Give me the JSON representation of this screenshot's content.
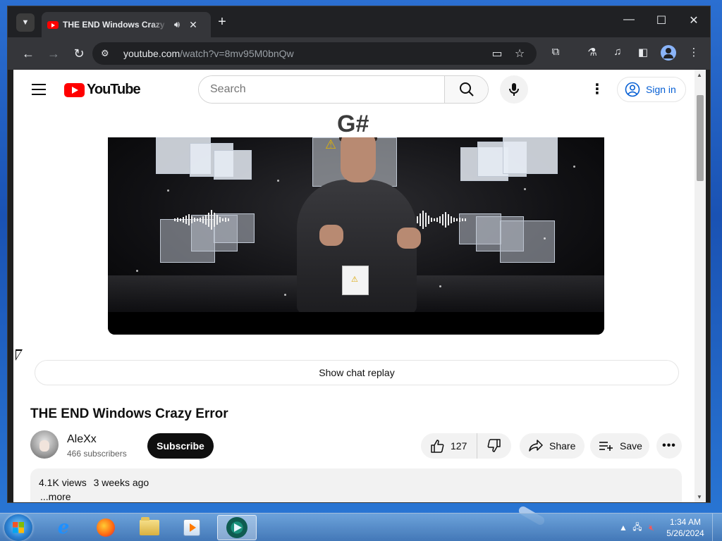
{
  "browser": {
    "tab": {
      "title": "THE END Windows Crazy Error",
      "audio_icon": "speaker-icon",
      "close_glyph": "✕"
    },
    "new_tab_glyph": "+",
    "window_controls": {
      "minimize": "—",
      "maximize": "☐",
      "close": "✕"
    },
    "address": {
      "host": "youtube.com",
      "path": "/watch?v=8mv95M0bnQw"
    },
    "colors": {
      "frame": "#202124",
      "toolbar": "#35363a",
      "omnibox": "#202124"
    }
  },
  "youtube": {
    "logo_text": "YouTube",
    "search": {
      "placeholder": "Search"
    },
    "signin_label": "Sign in",
    "video": {
      "overlay_text": "G#",
      "title": "THE END Windows Crazy Error"
    },
    "chat_replay_label": "Show chat replay",
    "channel": {
      "name": "AleXx",
      "subscribers": "466 subscribers"
    },
    "subscribe_label": "Subscribe",
    "actions": {
      "likes": "127",
      "share_label": "Share",
      "save_label": "Save"
    },
    "description": {
      "views": "4.1K views",
      "age": "3 weeks ago",
      "more_label": "...more"
    },
    "colors": {
      "brand_red": "#ff0000",
      "link_blue": "#065fd4",
      "subscribe_bg": "#0f0f0f"
    }
  },
  "taskbar": {
    "clock_time": "1:34 AM",
    "clock_date": "5/26/2024",
    "apps": [
      "internet-explorer-icon",
      "firefox-icon",
      "file-explorer-icon",
      "media-player-icon",
      "chrome-remote-icon"
    ]
  }
}
